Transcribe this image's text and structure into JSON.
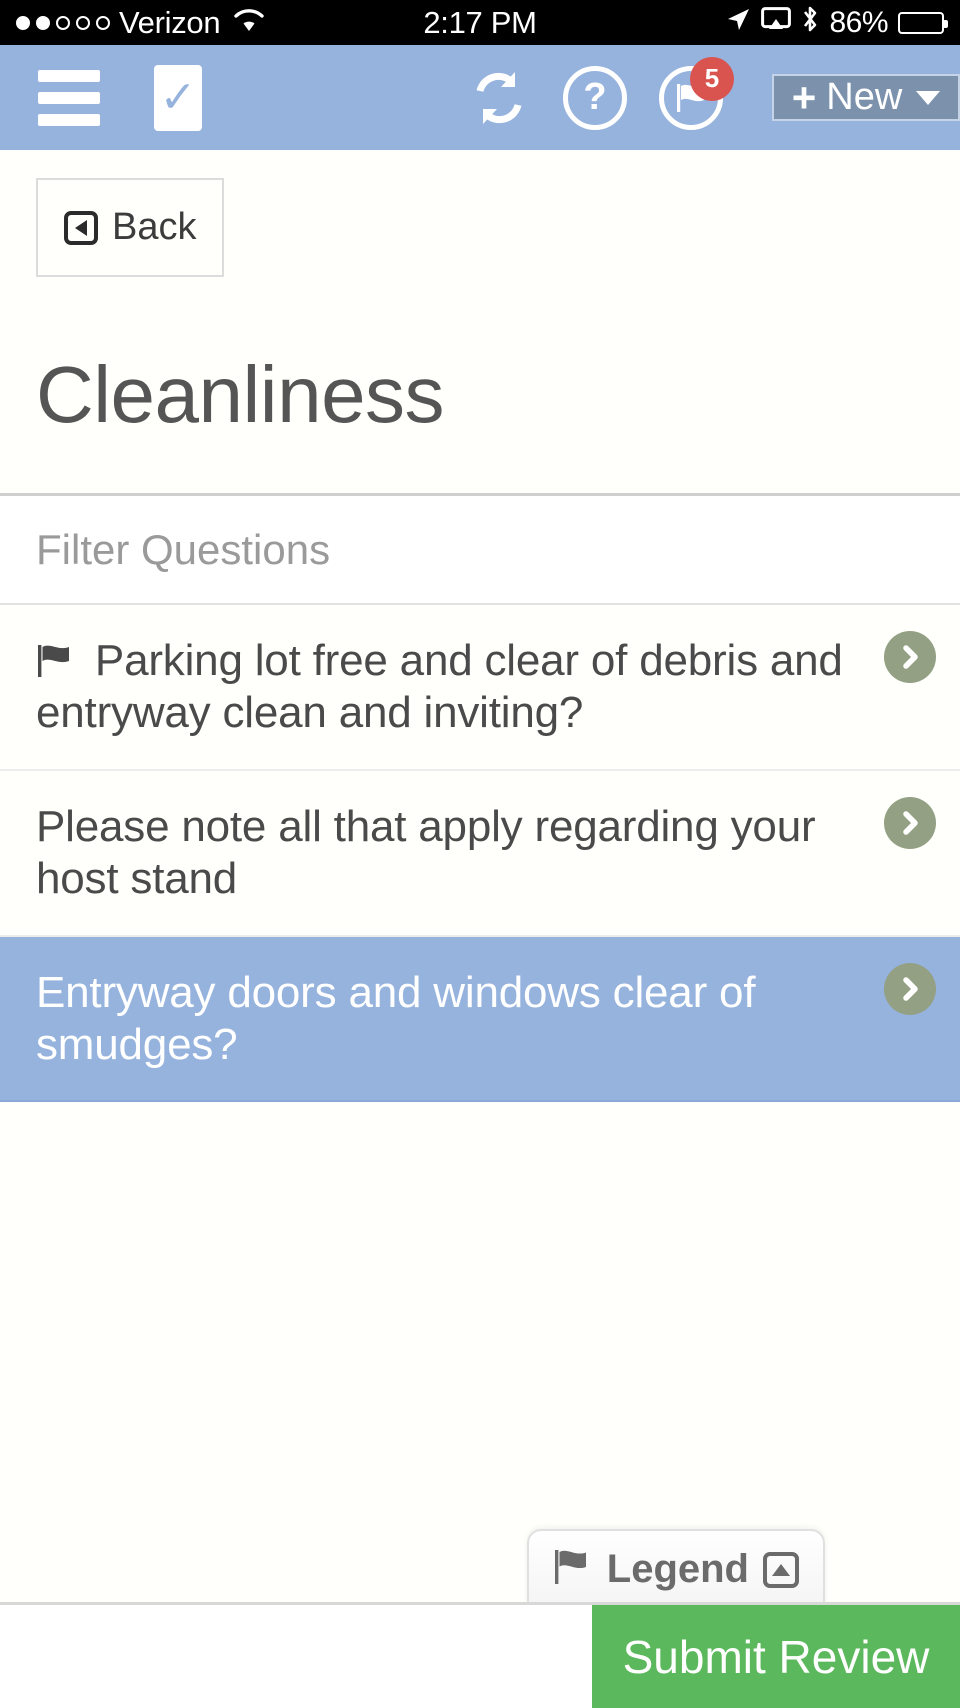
{
  "status_bar": {
    "signal_dots_total": 5,
    "signal_dots_filled": 2,
    "carrier": "Verizon",
    "wifi_icon": "wifi-icon",
    "time": "2:17 PM",
    "location_icon": "location-arrow-icon",
    "airplay_icon": "airplay-icon",
    "bluetooth_icon": "bluetooth-icon",
    "battery_percent": "86%",
    "battery_level": 86
  },
  "header": {
    "menu_icon": "hamburger-menu-icon",
    "logo_icon": "clipboard-check-logo",
    "logo_glyph": "✓",
    "refresh_icon": "sync-refresh-icon",
    "help_icon": "help-question-icon",
    "help_glyph": "?",
    "flag_icon": "flag-icon",
    "flag_badge_count": "5",
    "new_button_label": "New",
    "new_button_plus": "+",
    "accent_blue": "#96b3de",
    "new_button_bg": "#7c92ac",
    "badge_color": "#d9534f"
  },
  "toolbar": {
    "back_label": "Back",
    "back_icon": "back-arrow-box-icon"
  },
  "main": {
    "title": "Cleanliness",
    "filter": {
      "placeholder": "Filter Questions",
      "value": ""
    },
    "questions": [
      {
        "text": "Parking lot free and clear of debris and entryway clean and inviting?",
        "flagged": true,
        "flag_glyph": "⚑",
        "selected": false
      },
      {
        "text": "Please note all that apply regarding your host stand",
        "flagged": false,
        "selected": false
      },
      {
        "text": "Entryway doors and windows clear of smudges?",
        "flagged": false,
        "selected": true
      }
    ],
    "arrow_icon": "chevron-right-circle-icon",
    "arrow_color": "#94a084",
    "selected_row_bg": "#96b3de"
  },
  "footer": {
    "legend_label": "Legend",
    "legend_flag_icon": "flag-icon",
    "legend_toggle_icon": "triangle-up-box-icon",
    "submit_label": "Submit Review",
    "submit_color": "#5cb85c"
  }
}
